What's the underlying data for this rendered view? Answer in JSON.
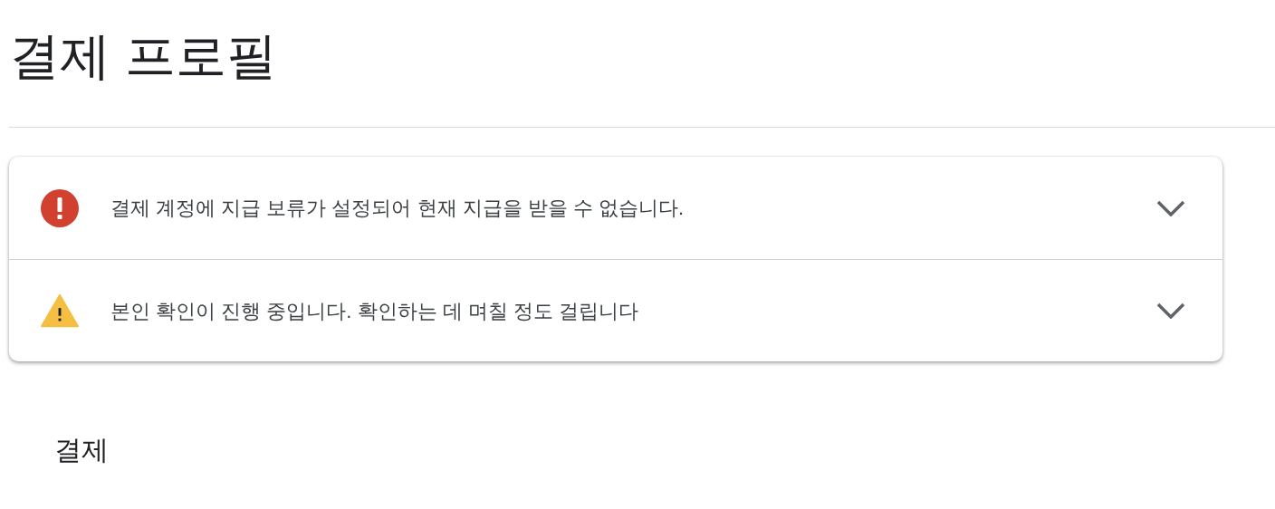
{
  "page_title": "결제 프로필",
  "alerts": [
    {
      "kind": "error",
      "message": "결제 계정에 지급 보류가 설정되어 현재 지급을 받을 수 없습니다.",
      "expanded": false
    },
    {
      "kind": "warning",
      "message": "본인 확인이 진행 중입니다. 확인하는 데 며칠 정도 걸립니다",
      "expanded": false
    }
  ],
  "section_heading": "결제"
}
